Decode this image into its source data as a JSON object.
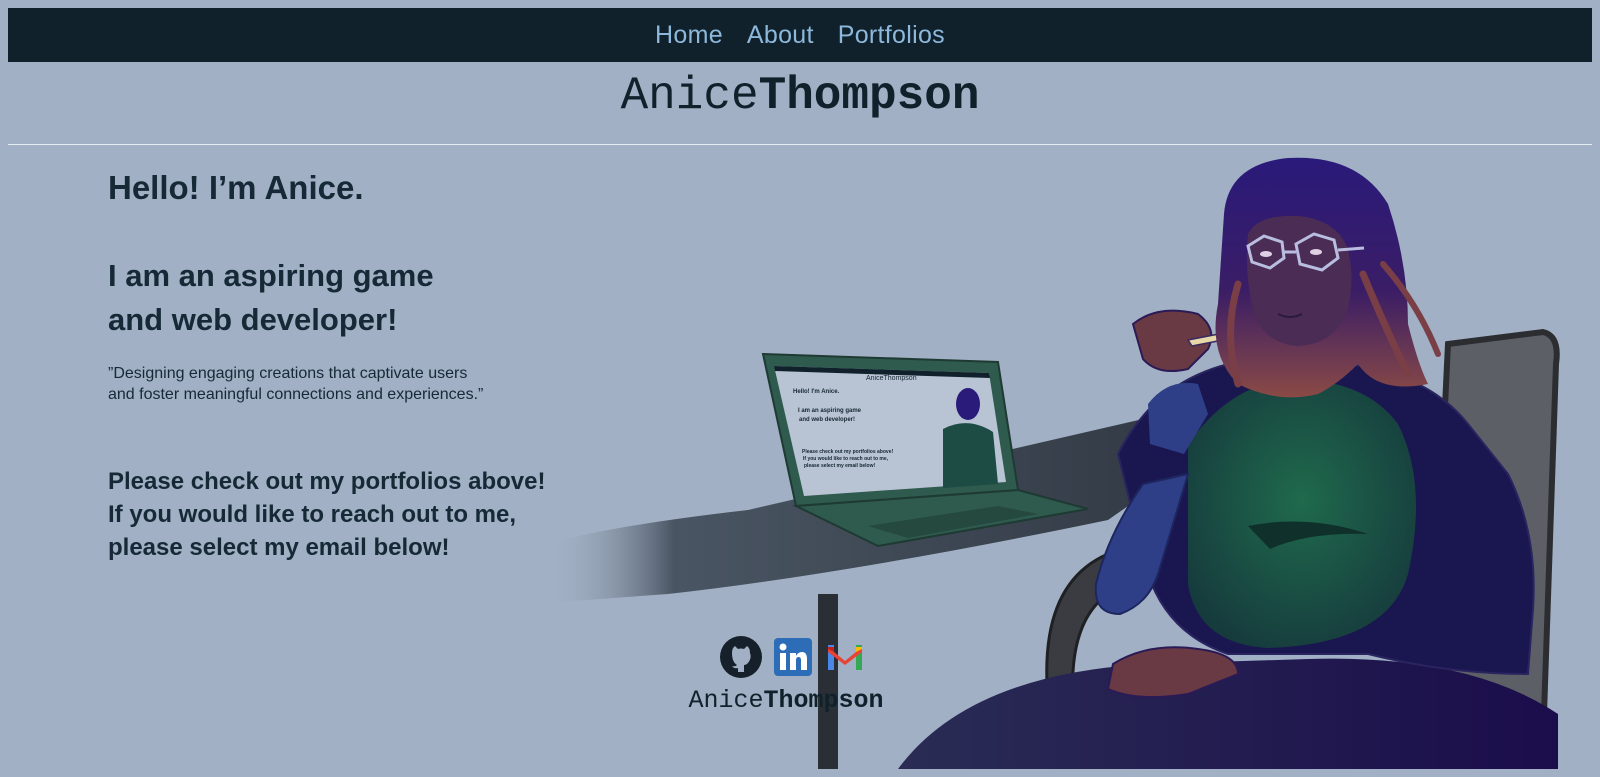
{
  "nav": {
    "items": [
      {
        "label": "Home"
      },
      {
        "label": "About"
      },
      {
        "label": "Portfolios"
      }
    ]
  },
  "logo": {
    "first": "Anice",
    "last": "Thompson"
  },
  "hero": {
    "greeting": "Hello! I’m Anice.",
    "tagline_line1": "I am an aspiring game",
    "tagline_line2": "and web developer!",
    "quote_line1": "”Designing engaging creations that captivate users",
    "quote_line2": "and foster meaningful connections and experiences.”",
    "cta_line1": "Please check out my portfolios above!",
    "cta_line2": "If you would like to reach out to me,",
    "cta_line3": "please select my email below!"
  },
  "social": {
    "items": [
      {
        "icon": "github-icon"
      },
      {
        "icon": "linkedin-icon"
      },
      {
        "icon": "gmail-icon"
      }
    ]
  },
  "footer": {
    "first": "Anice",
    "last": "Thompson"
  },
  "colors": {
    "nav_bg": "#10212b",
    "nav_link": "#8db8dc",
    "page_bg": "#a1b0c4",
    "text": "#152a36"
  }
}
